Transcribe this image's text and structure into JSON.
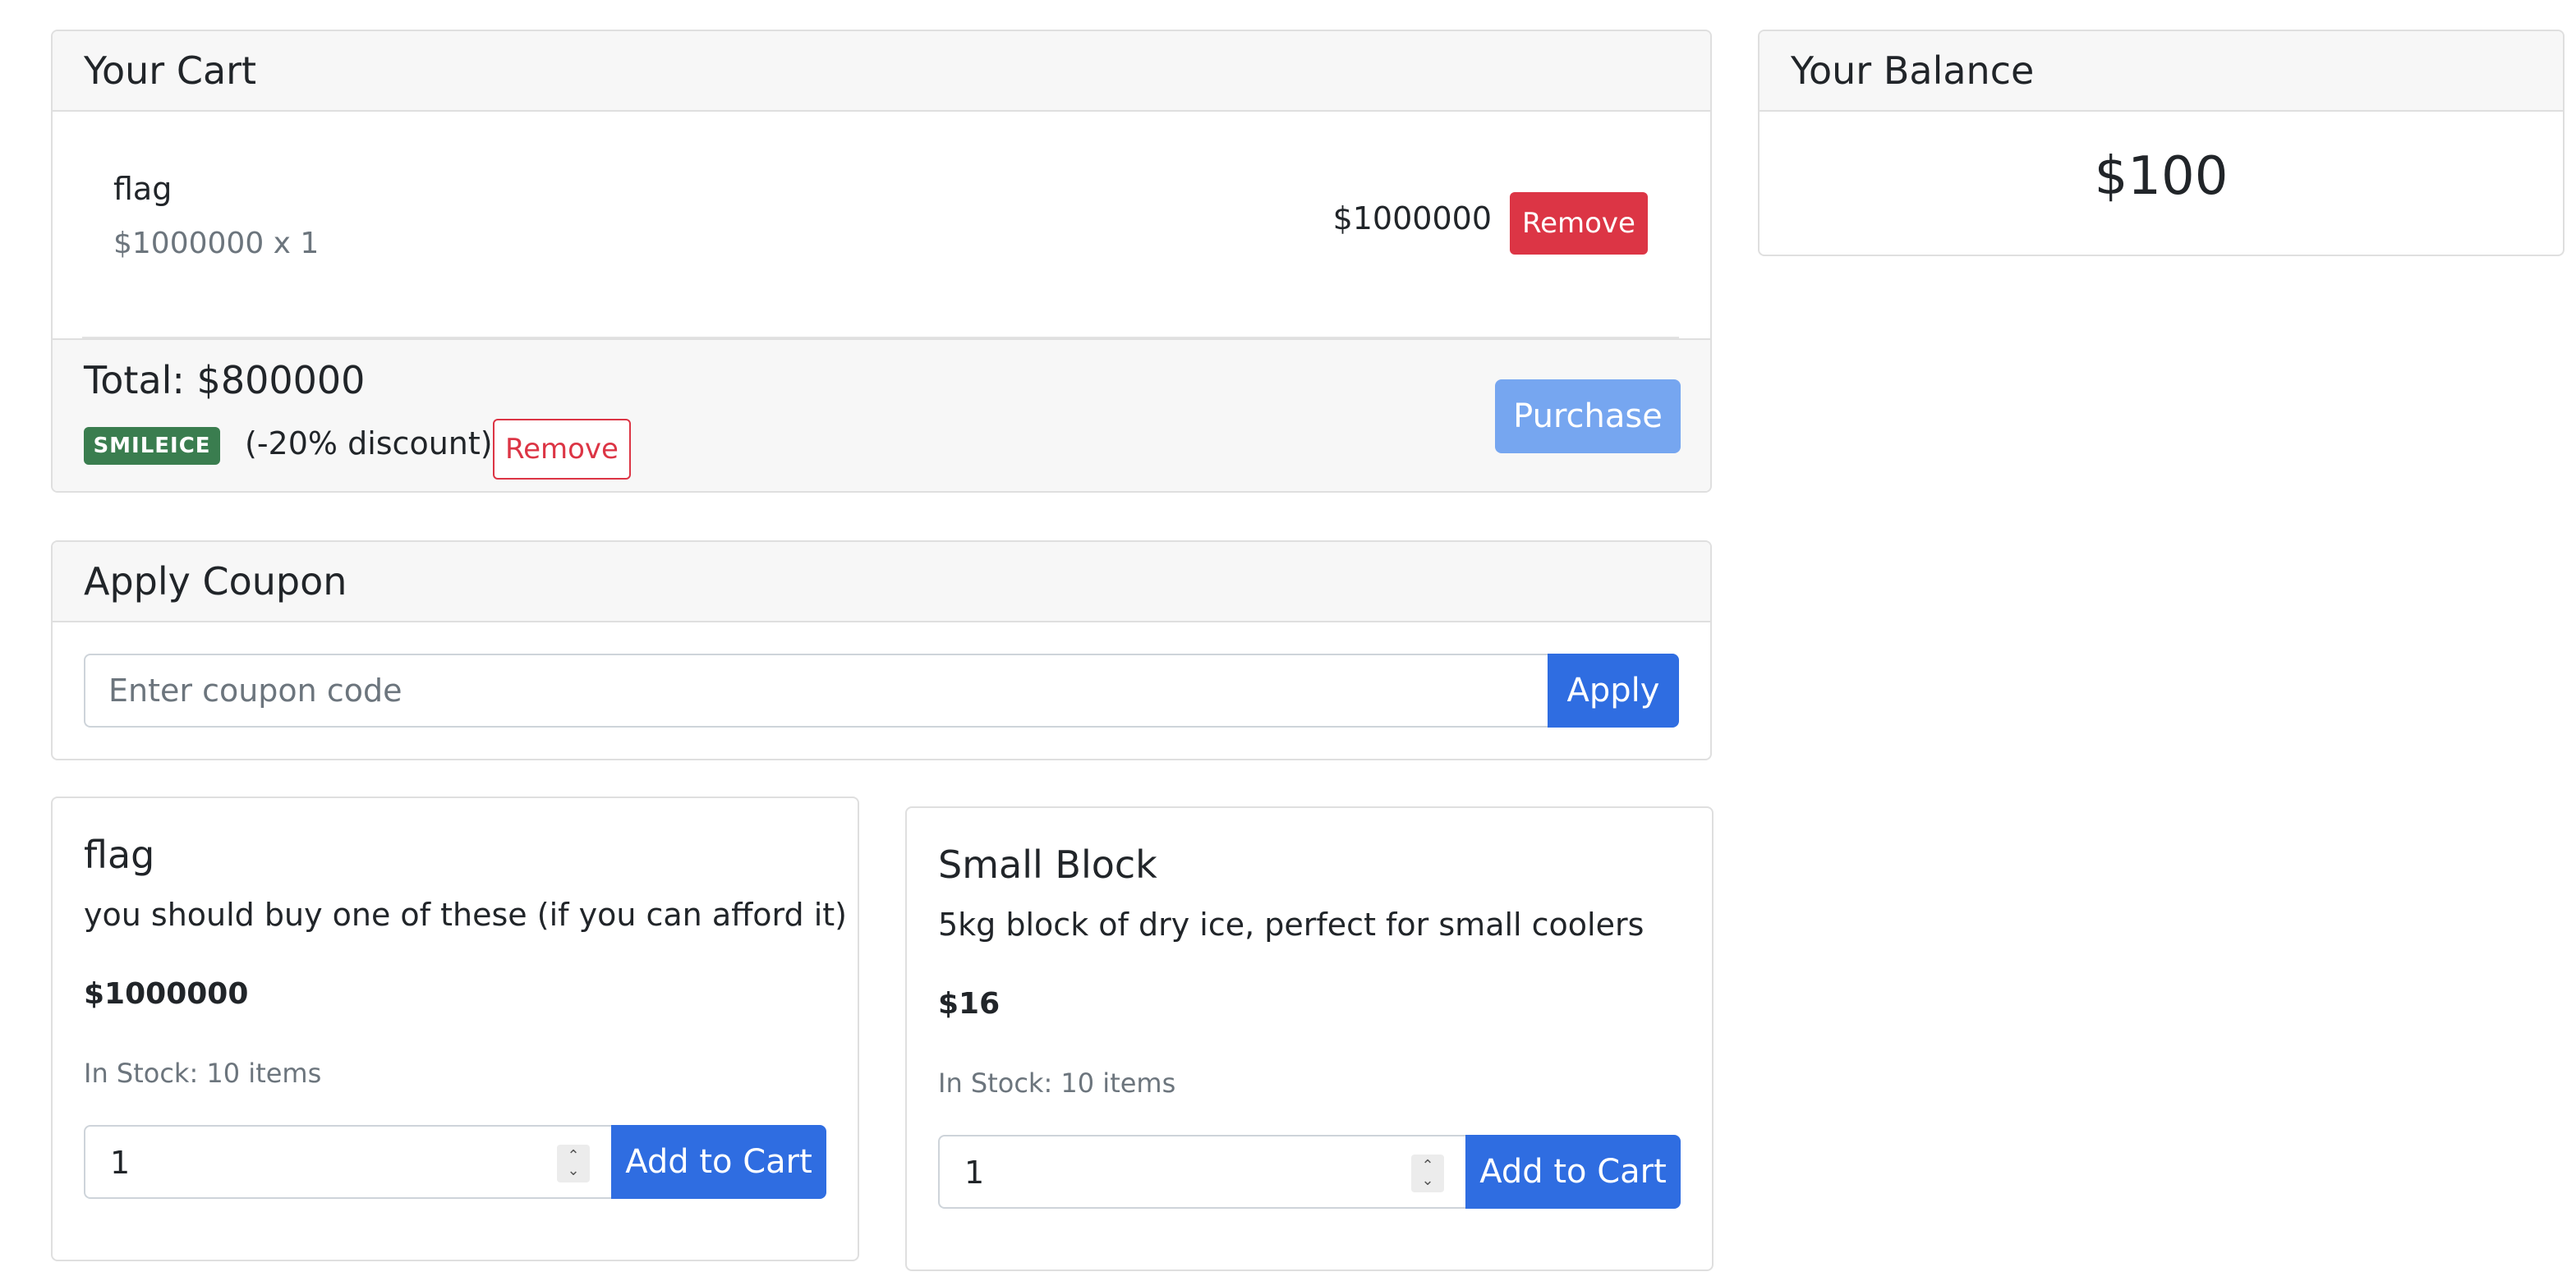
{
  "cart": {
    "title": "Your Cart",
    "items": [
      {
        "name": "flag",
        "unit_line": "$1000000 x 1",
        "line_total": "$1000000",
        "remove_label": "Remove"
      }
    ],
    "total_label": "Total: $800000",
    "coupon_badge": "SMILEICE",
    "discount_text": "(-20% discount)",
    "coupon_remove_label": "Remove",
    "purchase_label": "Purchase"
  },
  "balance": {
    "title": "Your Balance",
    "amount": "$100"
  },
  "coupon": {
    "title": "Apply Coupon",
    "placeholder": "Enter coupon code",
    "apply_label": "Apply"
  },
  "products": [
    {
      "name": "flag",
      "description": "you should buy one of these (if you can afford it)",
      "price": "$1000000",
      "stock": "In Stock: 10 items",
      "quantity": "1",
      "add_label": "Add to Cart"
    },
    {
      "name": "Small Block",
      "description": "5kg block of dry ice, perfect for small coolers",
      "price": "$16",
      "stock": "In Stock: 10 items",
      "quantity": "1",
      "add_label": "Add to Cart"
    }
  ],
  "colors": {
    "primary": "#2f6de1",
    "primary_disabled": "#76a6f0",
    "danger": "#dc3545",
    "success_badge": "#3a7d4f"
  }
}
